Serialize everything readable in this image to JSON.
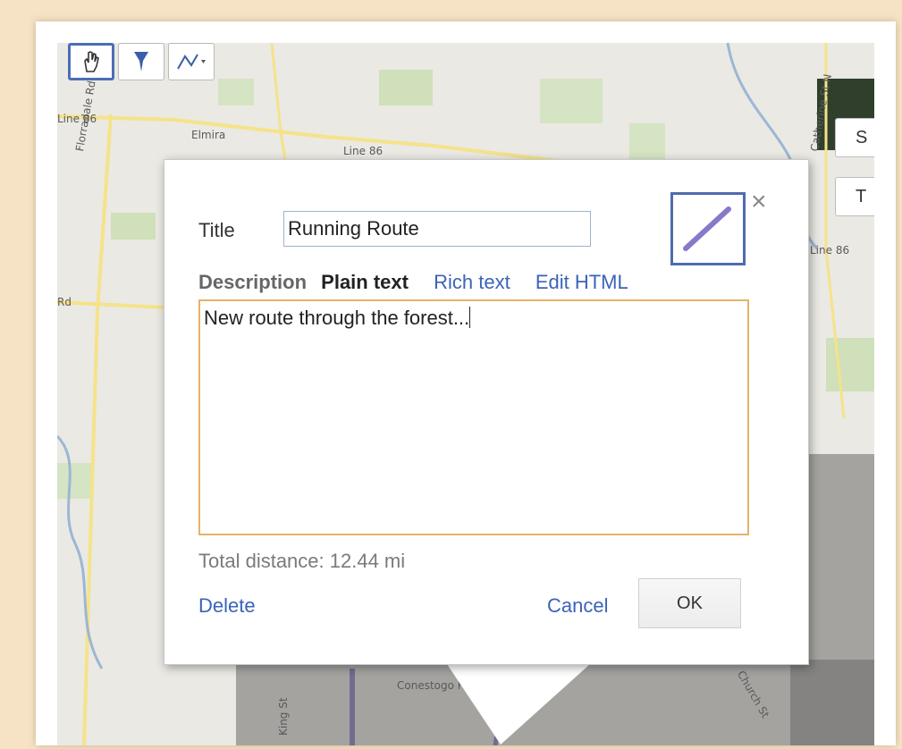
{
  "map": {
    "places": [
      "Elmira",
      "Line 86",
      "Line 86",
      "Line 86",
      "Florradale Rd",
      "Rd",
      "Catherine St N",
      "King St",
      "Conestogo River",
      "Church St"
    ],
    "right_buttons": [
      "S",
      "T"
    ]
  },
  "toolbar": {
    "tools": [
      "hand-tool-icon",
      "marker-tool-icon",
      "line-tool-icon"
    ]
  },
  "dialog": {
    "title_label": "Title",
    "title_value": "Running Route",
    "description_label": "Description",
    "mode_plain": "Plain text",
    "mode_rich": "Rich text",
    "mode_html": "Edit HTML",
    "description_value": "New route through the forest...",
    "total_distance": "Total distance: 12.44 mi",
    "delete_label": "Delete",
    "cancel_label": "Cancel",
    "ok_label": "OK",
    "close_glyph": "×",
    "line_color": "#8a78c8"
  }
}
